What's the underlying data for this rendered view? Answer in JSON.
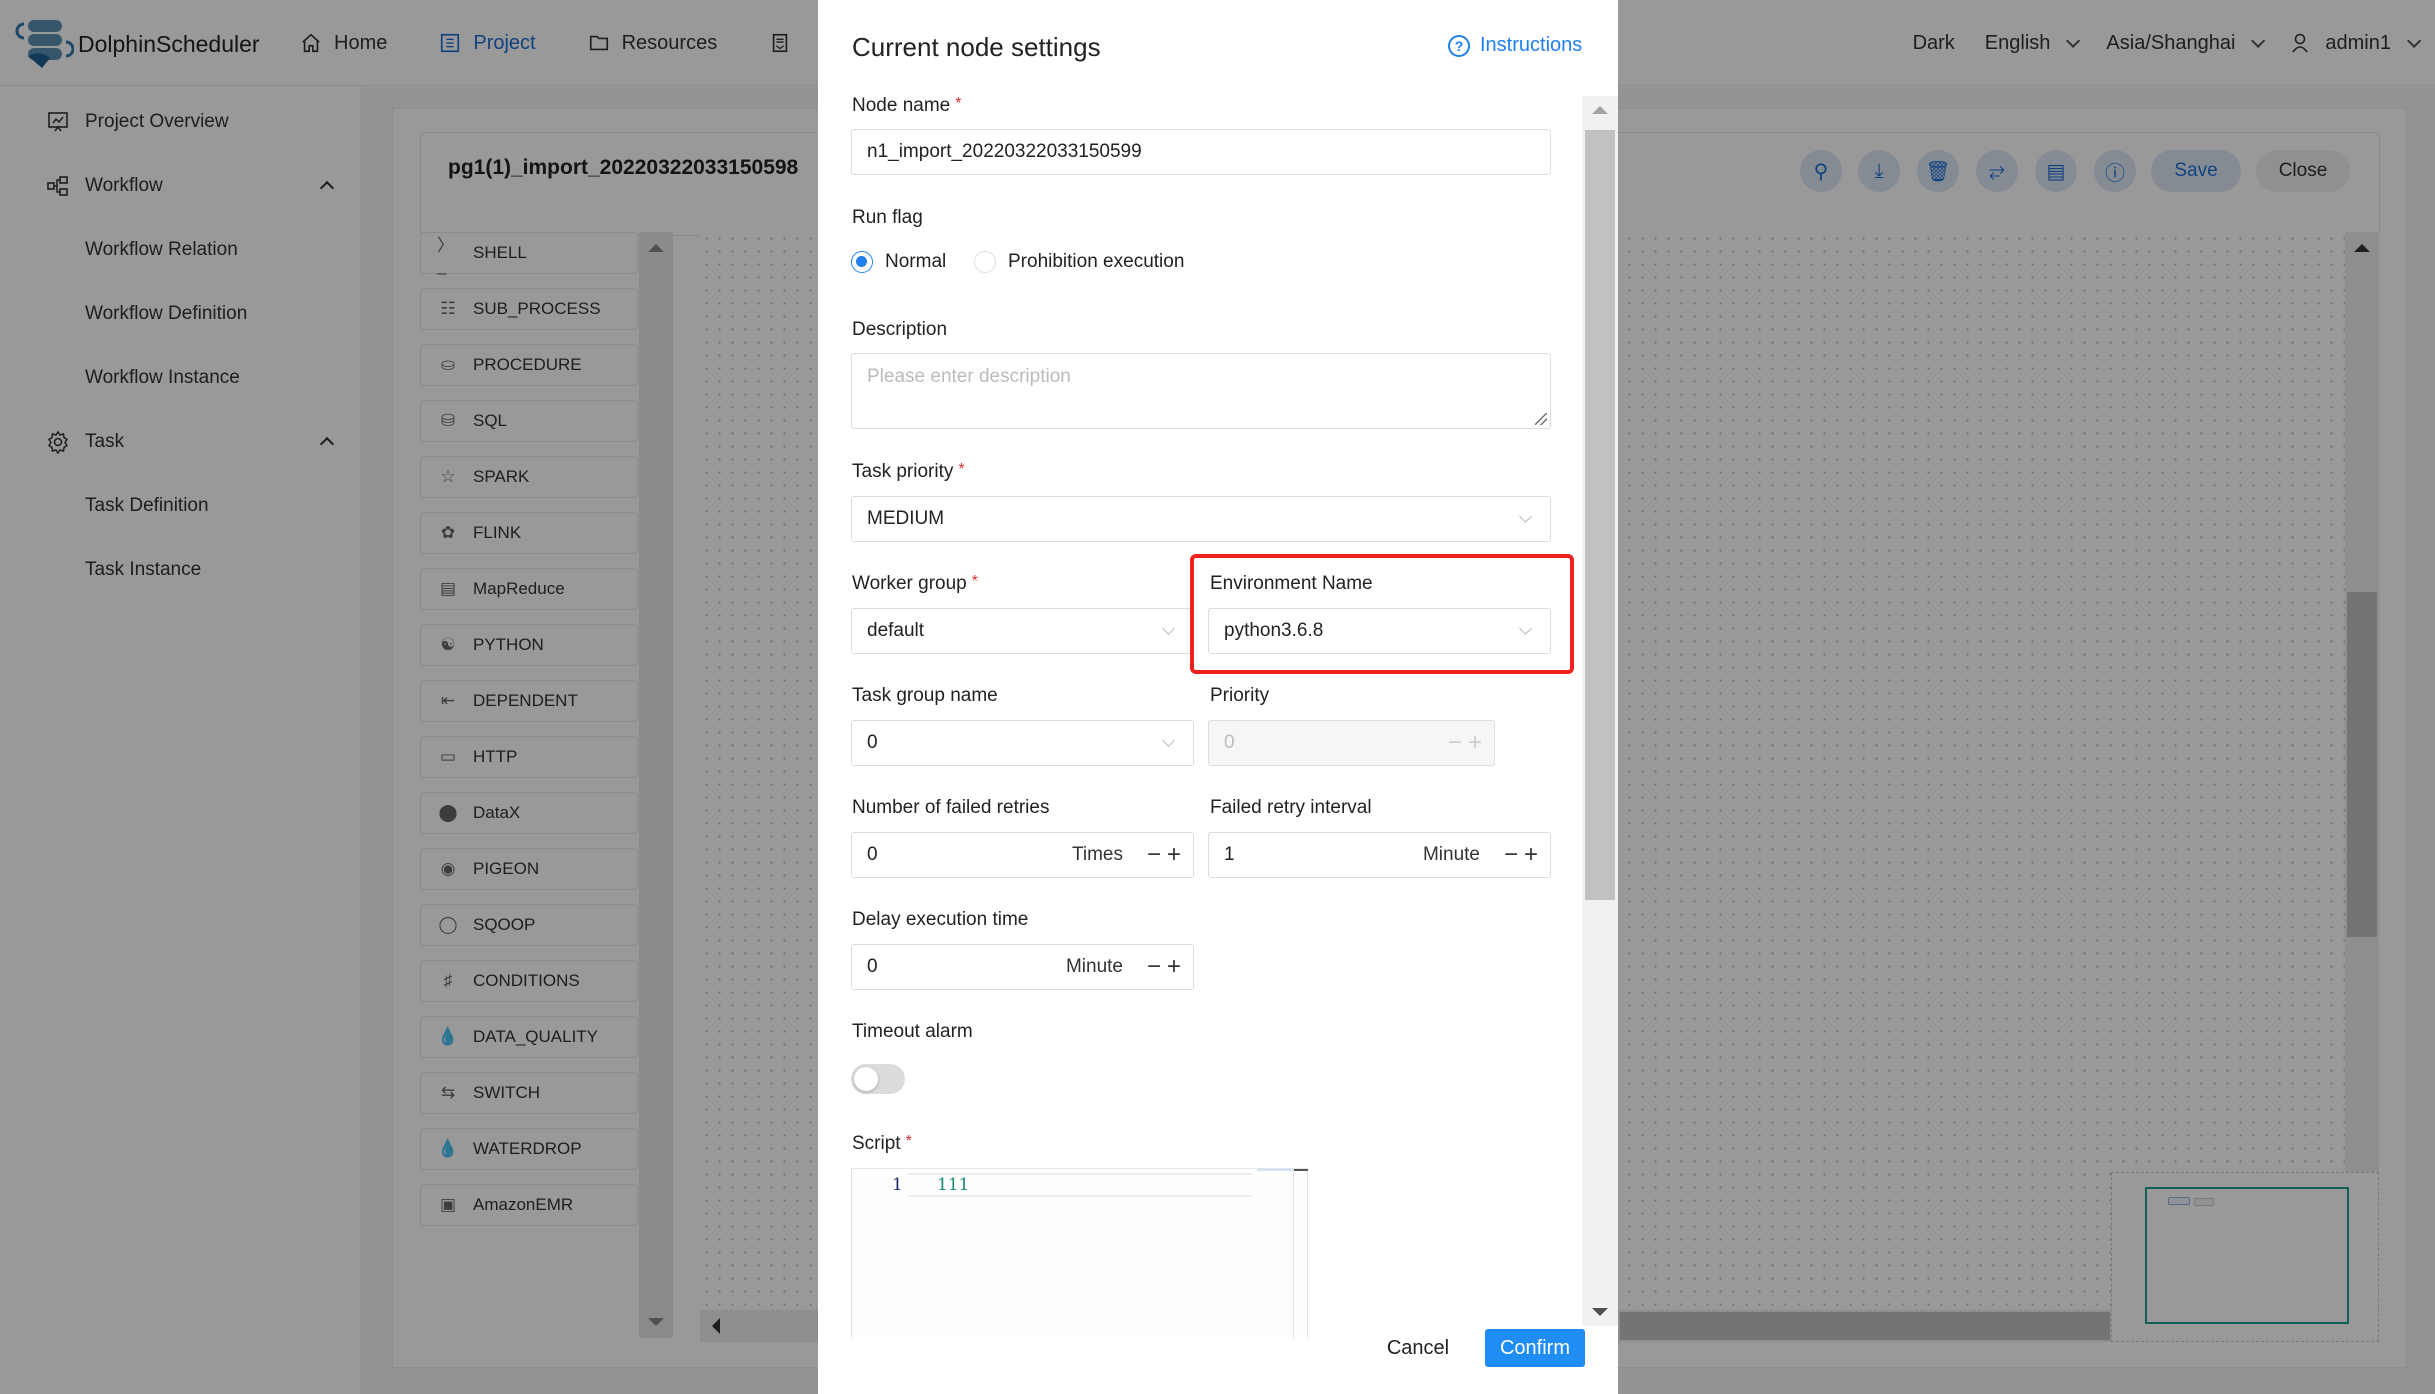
{
  "header": {
    "app_name": "DolphinScheduler",
    "nav": [
      {
        "label": "Home",
        "icon": "home-icon"
      },
      {
        "label": "Project",
        "icon": "project-icon",
        "active": true
      },
      {
        "label": "Resources",
        "icon": "folder-icon"
      }
    ],
    "theme_label": "Dark",
    "language": "English",
    "timezone": "Asia/Shanghai",
    "user": "admin1"
  },
  "sidebar": {
    "items": [
      {
        "label": "Project Overview",
        "icon": "chart-board-icon"
      },
      {
        "label": "Workflow",
        "icon": "workflow-icon",
        "expanded": true
      },
      {
        "label": "Workflow Relation"
      },
      {
        "label": "Workflow Definition"
      },
      {
        "label": "Workflow Instance"
      },
      {
        "label": "Task",
        "icon": "gear-icon",
        "expanded": true
      },
      {
        "label": "Task Definition"
      },
      {
        "label": "Task Instance"
      }
    ]
  },
  "workflow": {
    "title": "pg1(1)_import_20220322033150598",
    "toolbar": {
      "save_label": "Save",
      "close_label": "Close",
      "icons": [
        "search-icon",
        "download-icon",
        "delete-icon",
        "fullscreen-icon",
        "format-icon",
        "info-icon"
      ]
    },
    "task_types": [
      "SHELL",
      "SUB_PROCESS",
      "PROCEDURE",
      "SQL",
      "SPARK",
      "FLINK",
      "MapReduce",
      "PYTHON",
      "DEPENDENT",
      "HTTP",
      "DataX",
      "PIGEON",
      "SQOOP",
      "CONDITIONS",
      "DATA_QUALITY",
      "SWITCH",
      "WATERDROP",
      "AmazonEMR"
    ]
  },
  "dialog": {
    "title": "Current node settings",
    "instructions_label": "Instructions",
    "node_name": {
      "label": "Node name",
      "value": "n1_import_20220322033150599"
    },
    "run_flag": {
      "label": "Run flag",
      "options": [
        "Normal",
        "Prohibition execution"
      ],
      "selected": "Normal"
    },
    "description": {
      "label": "Description",
      "placeholder": "Please enter description",
      "value": ""
    },
    "task_priority": {
      "label": "Task priority",
      "value": "MEDIUM"
    },
    "worker_group": {
      "label": "Worker group",
      "value": "default"
    },
    "environment_name": {
      "label": "Environment Name",
      "value": "python3.6.8"
    },
    "task_group_name": {
      "label": "Task group name",
      "value": "0"
    },
    "priority": {
      "label": "Priority",
      "value": "0"
    },
    "failed_retries": {
      "label": "Number of failed retries",
      "value": "0",
      "unit": "Times"
    },
    "retry_interval": {
      "label": "Failed retry interval",
      "value": "1",
      "unit": "Minute"
    },
    "delay_time": {
      "label": "Delay execution time",
      "value": "0",
      "unit": "Minute"
    },
    "timeout_alarm": {
      "label": "Timeout alarm",
      "enabled": false
    },
    "script": {
      "label": "Script",
      "line_number": "1",
      "code": "111"
    },
    "cancel_label": "Cancel",
    "confirm_label": "Confirm",
    "highlight_color": "#f21f1f",
    "accent_color": "#2080f0"
  }
}
